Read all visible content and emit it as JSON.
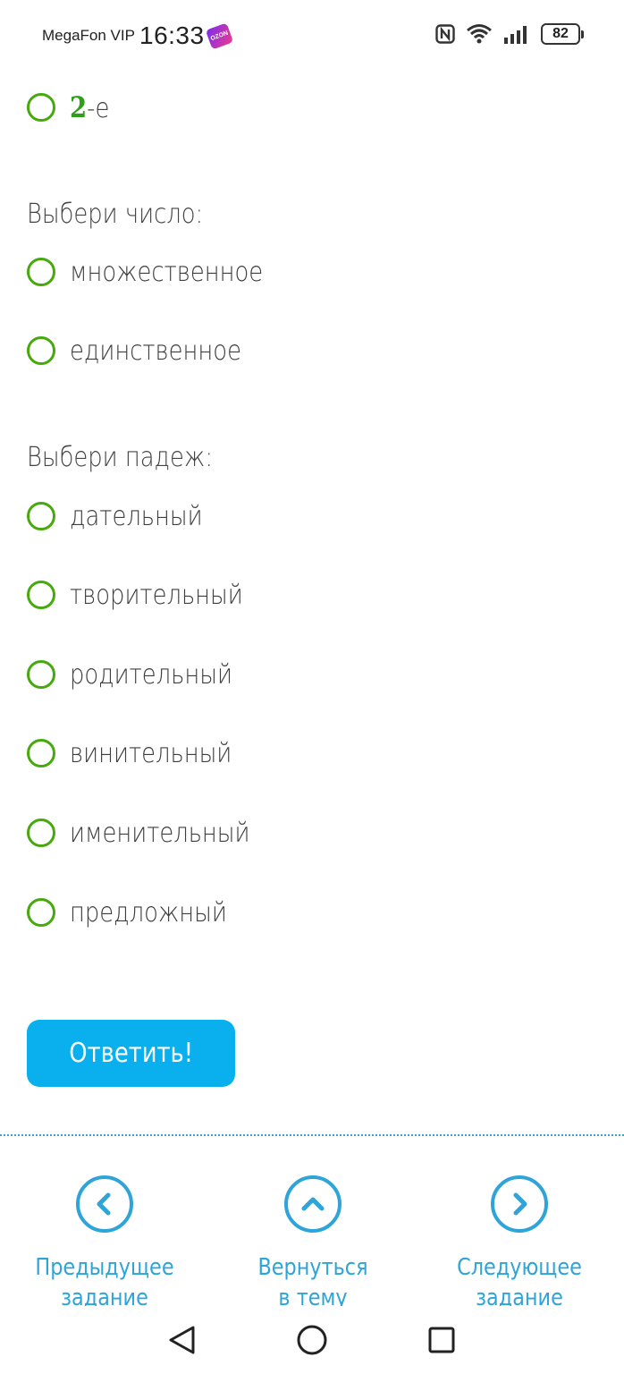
{
  "status_bar": {
    "carrier": "MegaFon VIP",
    "time": "16:33",
    "ozon_badge": "OZON",
    "battery": "82"
  },
  "options_top": [
    {
      "num": "2",
      "suffix": "-е"
    }
  ],
  "question_number": {
    "title": "Выбери число:",
    "options": [
      "множественное",
      "единственное"
    ]
  },
  "question_case": {
    "title": "Выбери падеж:",
    "options": [
      "дательный",
      "творительный",
      "родительный",
      "винительный",
      "именительный",
      "предложный"
    ]
  },
  "answer_button": "Ответить!",
  "bottom_nav": {
    "prev": [
      "Предыдущее",
      "задание"
    ],
    "up": [
      "Вернуться",
      "в тему"
    ],
    "next": [
      "Следующее",
      "задание"
    ]
  },
  "colors": {
    "radio": "#48a90e",
    "button": "#0ab0ee",
    "nav": "#2ea4d8"
  }
}
